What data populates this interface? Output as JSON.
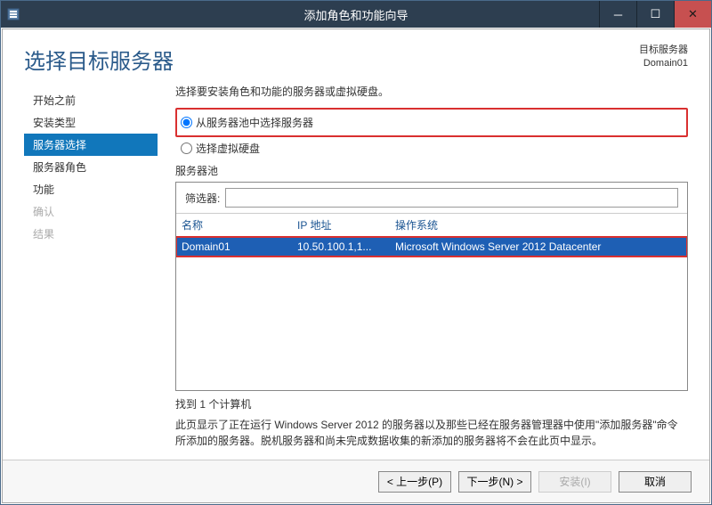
{
  "window": {
    "title": "添加角色和功能向导"
  },
  "header": {
    "title": "选择目标服务器",
    "meta_label": "目标服务器",
    "meta_value": "Domain01"
  },
  "sidebar": {
    "items": [
      {
        "label": "开始之前"
      },
      {
        "label": "安装类型"
      },
      {
        "label": "服务器选择"
      },
      {
        "label": "服务器角色"
      },
      {
        "label": "功能"
      },
      {
        "label": "确认"
      },
      {
        "label": "结果"
      }
    ]
  },
  "main": {
    "instruction": "选择要安装角色和功能的服务器或虚拟硬盘。",
    "radio_pool": "从服务器池中选择服务器",
    "radio_vhd": "选择虚拟硬盘",
    "pool_label": "服务器池",
    "filter_label": "筛选器:",
    "filter_value": "",
    "columns": {
      "name": "名称",
      "ip": "IP 地址",
      "os": "操作系统"
    },
    "rows": [
      {
        "name": "Domain01",
        "ip": "10.50.100.1,1...",
        "os": "Microsoft Windows Server 2012 Datacenter"
      }
    ],
    "summary": "找到 1 个计算机",
    "note": "此页显示了正在运行 Windows Server 2012 的服务器以及那些已经在服务器管理器中使用\"添加服务器\"命令所添加的服务器。脱机服务器和尚未完成数据收集的新添加的服务器将不会在此页中显示。"
  },
  "footer": {
    "prev": "< 上一步(P)",
    "next": "下一步(N) >",
    "install": "安装(I)",
    "cancel": "取消"
  }
}
